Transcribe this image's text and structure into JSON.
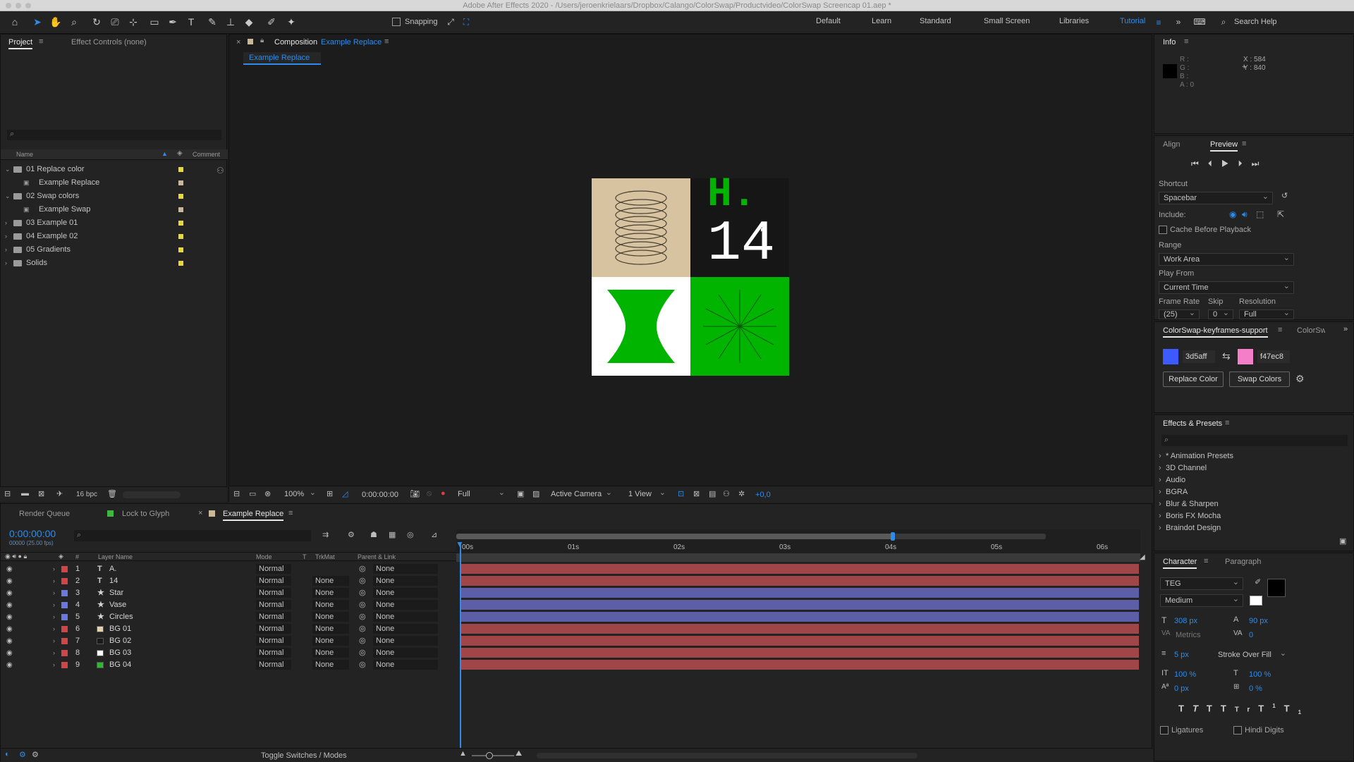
{
  "window": {
    "title": "Adobe After Effects 2020 - /Users/jeroenkrielaars/Dropbox/Calango/ColorSwap/Productvideo/ColorSwap Screencap 01.aep *"
  },
  "toolbar": {
    "snapping_label": "Snapping",
    "workspaces": [
      "Default",
      "Learn",
      "Standard",
      "Small Screen",
      "Libraries",
      "Tutorial"
    ],
    "active_workspace": "Tutorial",
    "search_placeholder": "Search Help"
  },
  "project": {
    "tab_project": "Project",
    "tab_effect_controls": "Effect Controls (none)",
    "col_name": "Name",
    "col_comment": "Comment",
    "items": [
      {
        "label": "01 Replace color",
        "type": "folder",
        "open": true,
        "color": "#e8d838"
      },
      {
        "label": "Example Replace",
        "type": "comp",
        "child": true,
        "color": "#c9b896"
      },
      {
        "label": "02 Swap colors",
        "type": "folder",
        "open": true,
        "color": "#e8d838"
      },
      {
        "label": "Example Swap",
        "type": "comp",
        "child": true,
        "color": "#c9b896"
      },
      {
        "label": "03 Example 01",
        "type": "folder",
        "color": "#e8d838"
      },
      {
        "label": "04 Example 02",
        "type": "folder",
        "color": "#e8d838"
      },
      {
        "label": "05 Gradients",
        "type": "folder",
        "color": "#e8d838"
      },
      {
        "label": "Solids",
        "type": "folder",
        "color": "#e8d838"
      }
    ],
    "bpc": "16 bpc"
  },
  "composition": {
    "panel_label": "Composition",
    "comp_name": "Example Replace",
    "sub_tab": "Example Replace",
    "zoom": "100%",
    "timecode": "0:00:00:00",
    "resolution": "Full",
    "camera": "Active Camera",
    "views": "1 View",
    "exposure": "+0,0",
    "artwork": {
      "top_right_line1": "H.",
      "top_right_line2": "14"
    }
  },
  "info": {
    "title": "Info",
    "r": "R :",
    "g": "G :",
    "b": "B :",
    "a": "A : 0",
    "x": "X : 584",
    "y": "Y : 840"
  },
  "preview": {
    "tab_align": "Align",
    "tab_preview": "Preview",
    "shortcut_label": "Shortcut",
    "shortcut_value": "Spacebar",
    "include_label": "Include:",
    "cache_label": "Cache Before Playback",
    "range_label": "Range",
    "range_value": "Work Area",
    "playfrom_label": "Play From",
    "playfrom_value": "Current Time",
    "framerate_label": "Frame Rate",
    "skip_label": "Skip",
    "resolution_label": "Resolution",
    "framerate_value": "(25)",
    "skip_value": "0",
    "resolution_value": "Full"
  },
  "colorswap": {
    "tab": "ColorSwap-keyframes-support",
    "tab2": "ColorSwi",
    "color1_hex": "3d5aff",
    "color1": "#3d5aff",
    "color2_hex": "f47ec8",
    "color2": "#f47ec8",
    "replace_btn": "Replace Color",
    "swap_btn": "Swap Colors"
  },
  "effects": {
    "title": "Effects & Presets",
    "items": [
      "* Animation Presets",
      "3D Channel",
      "Audio",
      "BGRA",
      "Blur & Sharpen",
      "Boris FX Mocha",
      "Braindot Design"
    ]
  },
  "character": {
    "tab_character": "Character",
    "tab_paragraph": "Paragraph",
    "font": "TEG",
    "style": "Medium",
    "size": "308 px",
    "leading": "90 px",
    "kerning": "Metrics",
    "tracking": "0",
    "stroke": "5 px",
    "stroke_type": "Stroke Over Fill",
    "vscale": "100 %",
    "hscale": "100 %",
    "baseline": "0 px",
    "tsume": "0 %",
    "ligatures": "Ligatures",
    "hindi": "Hindi Digits"
  },
  "timeline": {
    "tab_render": "Render Queue",
    "tab_lock": "Lock to Glyph",
    "tab_comp": "Example Replace",
    "timecode": "0:00:00:00",
    "timecode_sub": "00000 (25.00 fps)",
    "col_layer": "Layer Name",
    "col_mode": "Mode",
    "col_t": "T",
    "col_trkmat": "TrkMat",
    "col_parent": "Parent & Link",
    "ruler": [
      "00s",
      "01s",
      "02s",
      "03s",
      "04s",
      "05s",
      "06s"
    ],
    "layers": [
      {
        "num": "1",
        "type": "T",
        "name": "A.",
        "color": "#d04545",
        "mode": "Normal",
        "trkmat": "",
        "parent": "None",
        "bar": "#a14648"
      },
      {
        "num": "2",
        "type": "T",
        "name": "14",
        "color": "#d04545",
        "mode": "Normal",
        "trkmat": "None",
        "parent": "None",
        "bar": "#a14648"
      },
      {
        "num": "3",
        "type": "★",
        "name": "Star",
        "color": "#6a78e0",
        "mode": "Normal",
        "trkmat": "None",
        "parent": "None",
        "bar": "#5d5ea8"
      },
      {
        "num": "4",
        "type": "★",
        "name": "Vase",
        "color": "#6a78e0",
        "mode": "Normal",
        "trkmat": "None",
        "parent": "None",
        "bar": "#5d5ea8"
      },
      {
        "num": "5",
        "type": "★",
        "name": "Circles",
        "color": "#6a78e0",
        "mode": "Normal",
        "trkmat": "None",
        "parent": "None",
        "bar": "#5d5ea8"
      },
      {
        "num": "6",
        "type": "■",
        "name": "BG 01",
        "color": "#d04545",
        "mode": "Normal",
        "trkmat": "None",
        "parent": "None",
        "bar": "#a14648",
        "sw": "#e3d2b0"
      },
      {
        "num": "7",
        "type": "■",
        "name": "BG 02",
        "color": "#d04545",
        "mode": "Normal",
        "trkmat": "None",
        "parent": "None",
        "bar": "#a14648",
        "sw": "#1a1a1a"
      },
      {
        "num": "8",
        "type": "■",
        "name": "BG 03",
        "color": "#d04545",
        "mode": "Normal",
        "trkmat": "None",
        "parent": "None",
        "bar": "#a14648",
        "sw": "#ffffff"
      },
      {
        "num": "9",
        "type": "■",
        "name": "BG 04",
        "color": "#d04545",
        "mode": "Normal",
        "trkmat": "None",
        "parent": "None",
        "bar": "#a14648",
        "sw": "#2fb82f"
      }
    ],
    "toggle_label": "Toggle Switches / Modes"
  },
  "colors": {
    "accent": "#2d8ceb",
    "green": "#00b400",
    "beige": "#d8c3a0"
  }
}
